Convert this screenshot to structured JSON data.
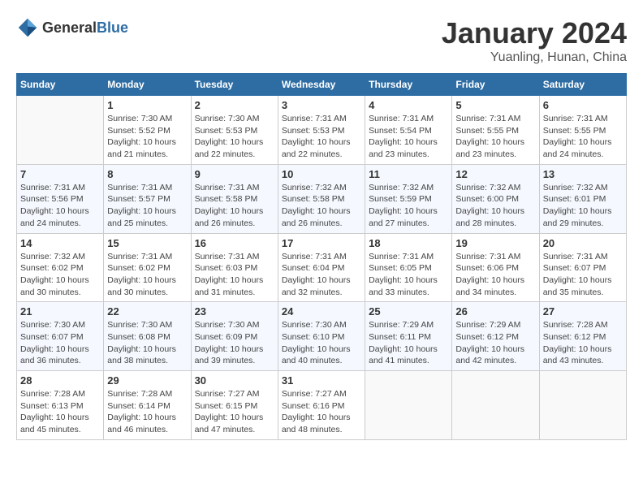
{
  "header": {
    "logo": {
      "text_general": "General",
      "text_blue": "Blue"
    },
    "title": "January 2024",
    "location": "Yuanling, Hunan, China"
  },
  "days_of_week": [
    "Sunday",
    "Monday",
    "Tuesday",
    "Wednesday",
    "Thursday",
    "Friday",
    "Saturday"
  ],
  "weeks": [
    [
      {
        "day": "",
        "sunrise": "",
        "sunset": "",
        "daylight": ""
      },
      {
        "day": "1",
        "sunrise": "Sunrise: 7:30 AM",
        "sunset": "Sunset: 5:52 PM",
        "daylight": "Daylight: 10 hours and 21 minutes."
      },
      {
        "day": "2",
        "sunrise": "Sunrise: 7:30 AM",
        "sunset": "Sunset: 5:53 PM",
        "daylight": "Daylight: 10 hours and 22 minutes."
      },
      {
        "day": "3",
        "sunrise": "Sunrise: 7:31 AM",
        "sunset": "Sunset: 5:53 PM",
        "daylight": "Daylight: 10 hours and 22 minutes."
      },
      {
        "day": "4",
        "sunrise": "Sunrise: 7:31 AM",
        "sunset": "Sunset: 5:54 PM",
        "daylight": "Daylight: 10 hours and 23 minutes."
      },
      {
        "day": "5",
        "sunrise": "Sunrise: 7:31 AM",
        "sunset": "Sunset: 5:55 PM",
        "daylight": "Daylight: 10 hours and 23 minutes."
      },
      {
        "day": "6",
        "sunrise": "Sunrise: 7:31 AM",
        "sunset": "Sunset: 5:55 PM",
        "daylight": "Daylight: 10 hours and 24 minutes."
      }
    ],
    [
      {
        "day": "7",
        "sunrise": "Sunrise: 7:31 AM",
        "sunset": "Sunset: 5:56 PM",
        "daylight": "Daylight: 10 hours and 24 minutes."
      },
      {
        "day": "8",
        "sunrise": "Sunrise: 7:31 AM",
        "sunset": "Sunset: 5:57 PM",
        "daylight": "Daylight: 10 hours and 25 minutes."
      },
      {
        "day": "9",
        "sunrise": "Sunrise: 7:31 AM",
        "sunset": "Sunset: 5:58 PM",
        "daylight": "Daylight: 10 hours and 26 minutes."
      },
      {
        "day": "10",
        "sunrise": "Sunrise: 7:32 AM",
        "sunset": "Sunset: 5:58 PM",
        "daylight": "Daylight: 10 hours and 26 minutes."
      },
      {
        "day": "11",
        "sunrise": "Sunrise: 7:32 AM",
        "sunset": "Sunset: 5:59 PM",
        "daylight": "Daylight: 10 hours and 27 minutes."
      },
      {
        "day": "12",
        "sunrise": "Sunrise: 7:32 AM",
        "sunset": "Sunset: 6:00 PM",
        "daylight": "Daylight: 10 hours and 28 minutes."
      },
      {
        "day": "13",
        "sunrise": "Sunrise: 7:32 AM",
        "sunset": "Sunset: 6:01 PM",
        "daylight": "Daylight: 10 hours and 29 minutes."
      }
    ],
    [
      {
        "day": "14",
        "sunrise": "Sunrise: 7:32 AM",
        "sunset": "Sunset: 6:02 PM",
        "daylight": "Daylight: 10 hours and 30 minutes."
      },
      {
        "day": "15",
        "sunrise": "Sunrise: 7:31 AM",
        "sunset": "Sunset: 6:02 PM",
        "daylight": "Daylight: 10 hours and 30 minutes."
      },
      {
        "day": "16",
        "sunrise": "Sunrise: 7:31 AM",
        "sunset": "Sunset: 6:03 PM",
        "daylight": "Daylight: 10 hours and 31 minutes."
      },
      {
        "day": "17",
        "sunrise": "Sunrise: 7:31 AM",
        "sunset": "Sunset: 6:04 PM",
        "daylight": "Daylight: 10 hours and 32 minutes."
      },
      {
        "day": "18",
        "sunrise": "Sunrise: 7:31 AM",
        "sunset": "Sunset: 6:05 PM",
        "daylight": "Daylight: 10 hours and 33 minutes."
      },
      {
        "day": "19",
        "sunrise": "Sunrise: 7:31 AM",
        "sunset": "Sunset: 6:06 PM",
        "daylight": "Daylight: 10 hours and 34 minutes."
      },
      {
        "day": "20",
        "sunrise": "Sunrise: 7:31 AM",
        "sunset": "Sunset: 6:07 PM",
        "daylight": "Daylight: 10 hours and 35 minutes."
      }
    ],
    [
      {
        "day": "21",
        "sunrise": "Sunrise: 7:30 AM",
        "sunset": "Sunset: 6:07 PM",
        "daylight": "Daylight: 10 hours and 36 minutes."
      },
      {
        "day": "22",
        "sunrise": "Sunrise: 7:30 AM",
        "sunset": "Sunset: 6:08 PM",
        "daylight": "Daylight: 10 hours and 38 minutes."
      },
      {
        "day": "23",
        "sunrise": "Sunrise: 7:30 AM",
        "sunset": "Sunset: 6:09 PM",
        "daylight": "Daylight: 10 hours and 39 minutes."
      },
      {
        "day": "24",
        "sunrise": "Sunrise: 7:30 AM",
        "sunset": "Sunset: 6:10 PM",
        "daylight": "Daylight: 10 hours and 40 minutes."
      },
      {
        "day": "25",
        "sunrise": "Sunrise: 7:29 AM",
        "sunset": "Sunset: 6:11 PM",
        "daylight": "Daylight: 10 hours and 41 minutes."
      },
      {
        "day": "26",
        "sunrise": "Sunrise: 7:29 AM",
        "sunset": "Sunset: 6:12 PM",
        "daylight": "Daylight: 10 hours and 42 minutes."
      },
      {
        "day": "27",
        "sunrise": "Sunrise: 7:28 AM",
        "sunset": "Sunset: 6:12 PM",
        "daylight": "Daylight: 10 hours and 43 minutes."
      }
    ],
    [
      {
        "day": "28",
        "sunrise": "Sunrise: 7:28 AM",
        "sunset": "Sunset: 6:13 PM",
        "daylight": "Daylight: 10 hours and 45 minutes."
      },
      {
        "day": "29",
        "sunrise": "Sunrise: 7:28 AM",
        "sunset": "Sunset: 6:14 PM",
        "daylight": "Daylight: 10 hours and 46 minutes."
      },
      {
        "day": "30",
        "sunrise": "Sunrise: 7:27 AM",
        "sunset": "Sunset: 6:15 PM",
        "daylight": "Daylight: 10 hours and 47 minutes."
      },
      {
        "day": "31",
        "sunrise": "Sunrise: 7:27 AM",
        "sunset": "Sunset: 6:16 PM",
        "daylight": "Daylight: 10 hours and 48 minutes."
      },
      {
        "day": "",
        "sunrise": "",
        "sunset": "",
        "daylight": ""
      },
      {
        "day": "",
        "sunrise": "",
        "sunset": "",
        "daylight": ""
      },
      {
        "day": "",
        "sunrise": "",
        "sunset": "",
        "daylight": ""
      }
    ]
  ]
}
